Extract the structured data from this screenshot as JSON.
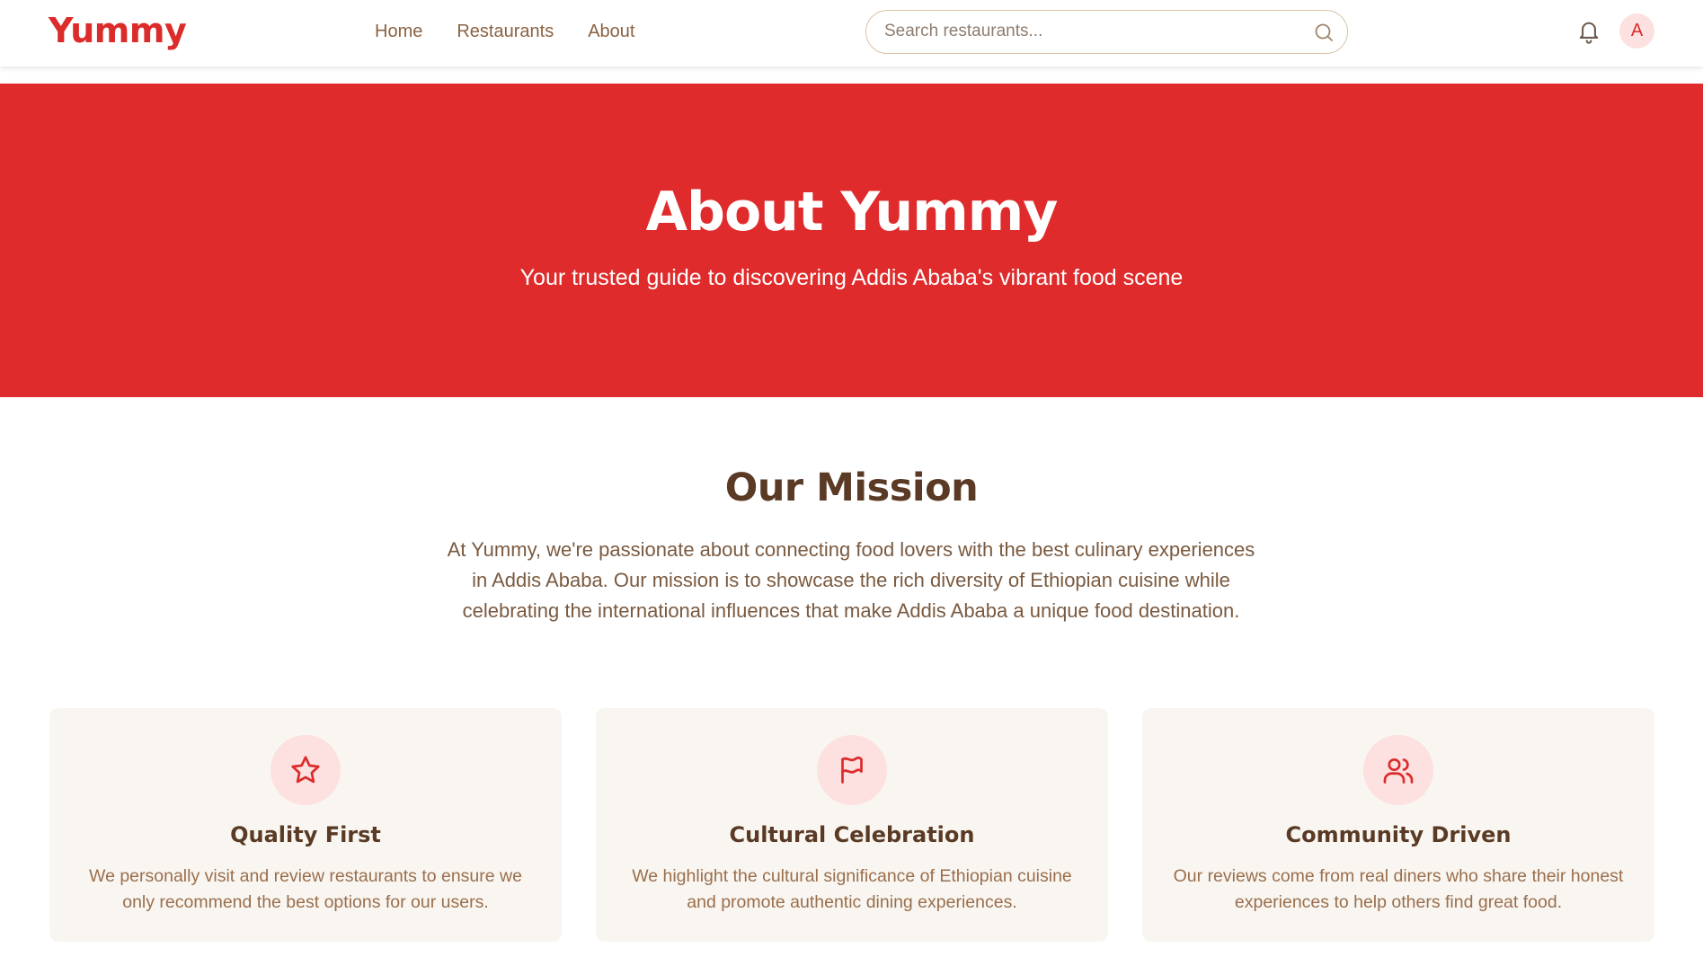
{
  "header": {
    "logo": "Yummy",
    "nav": [
      {
        "label": "Home"
      },
      {
        "label": "Restaurants"
      },
      {
        "label": "About"
      }
    ],
    "search_placeholder": "Search restaurants...",
    "avatar_initial": "A"
  },
  "hero": {
    "title": "About Yummy",
    "subtitle": "Your trusted guide to discovering Addis Ababa's vibrant food scene"
  },
  "mission": {
    "title": "Our Mission",
    "text": "At Yummy, we're passionate about connecting food lovers with the best culinary experiences in Addis Ababa. Our mission is to showcase the rich diversity of Ethiopian cuisine while celebrating the international influences that make Addis Ababa a unique food destination."
  },
  "cards": [
    {
      "icon": "star-icon",
      "title": "Quality First",
      "text": "We personally visit and review restaurants to ensure we only recommend the best options for our users."
    },
    {
      "icon": "flag-icon",
      "title": "Cultural Celebration",
      "text": "We highlight the cultural significance of Ethiopian cuisine and promote authentic dining experiences."
    },
    {
      "icon": "users-icon",
      "title": "Community Driven",
      "text": "Our reviews come from real diners who share their honest experiences to help others find great food."
    }
  ],
  "colors": {
    "brand": "#dc2b2b",
    "hero_bg": "#df2b2b",
    "text_brown": "#5a3a25",
    "card_bg": "#f9f6f1",
    "icon_bg": "#fde0e0"
  }
}
